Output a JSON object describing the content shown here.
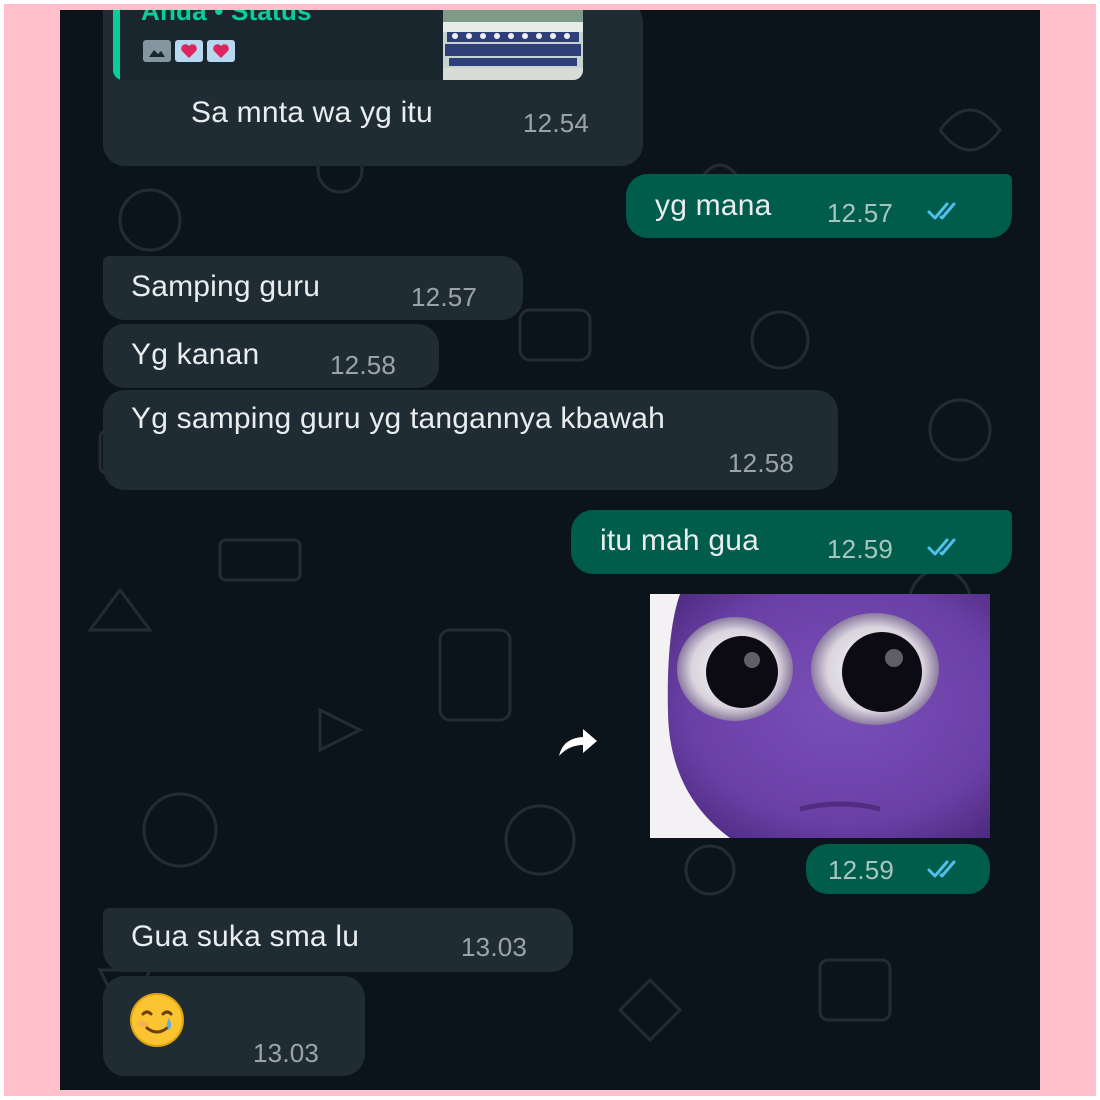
{
  "quoted_status": {
    "author": "Anda",
    "separator": "•",
    "label": "Status",
    "icons": [
      "image-icon",
      "heart-icon",
      "heart-icon"
    ]
  },
  "messages": [
    {
      "direction": "incoming",
      "text": "Sa mnta wa yg itu",
      "time": "12.54"
    },
    {
      "direction": "outgoing",
      "text": "yg mana",
      "time": "12.57",
      "status": "read"
    },
    {
      "direction": "incoming",
      "text": "Samping guru",
      "time": "12.57"
    },
    {
      "direction": "incoming",
      "text": "Yg kanan",
      "time": "12.58"
    },
    {
      "direction": "incoming",
      "text": "Yg samping guru yg tangannya kbawah",
      "time": "12.58"
    },
    {
      "direction": "outgoing",
      "text": "itu mah gua",
      "time": "12.59",
      "status": "read"
    },
    {
      "direction": "outgoing",
      "type": "sticker",
      "sticker": "purple-creature-wide-eyes",
      "time": "12.59",
      "status": "read"
    },
    {
      "direction": "incoming",
      "text": "Gua suka sma lu",
      "time": "13.03"
    },
    {
      "direction": "incoming",
      "type": "emoji",
      "emoji": "smiling-face-with-tear",
      "time": "13.03"
    }
  ],
  "actions": {
    "forward_icon": "forward-arrow-icon"
  },
  "colors": {
    "chat_background": "#0b141a",
    "incoming_bubble": "#202c33",
    "outgoing_bubble": "#005c4b",
    "accent": "#06cf9c",
    "read_ticks": "#53bdeb",
    "page_background": "#ffc0cb"
  }
}
